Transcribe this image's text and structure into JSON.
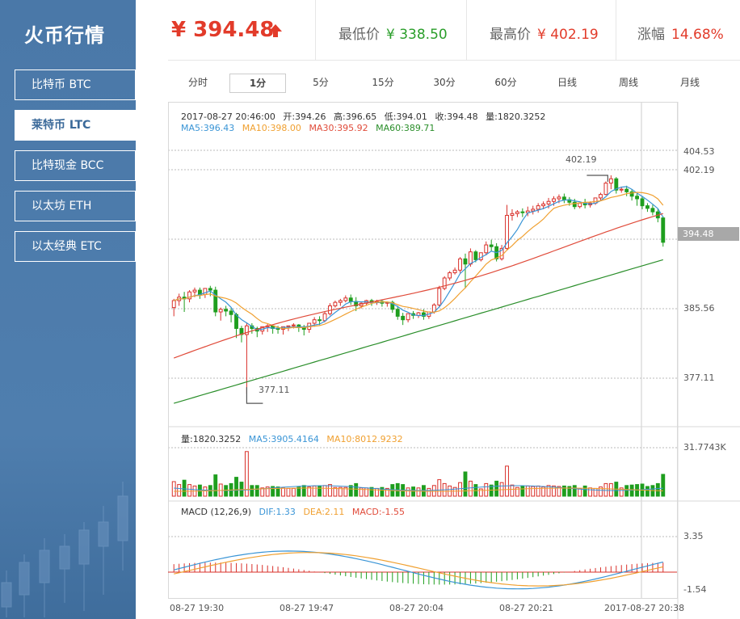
{
  "brand": "火币行情",
  "coins": [
    {
      "label": "比特币 BTC",
      "active": false
    },
    {
      "label": "莱特币 LTC",
      "active": true
    },
    {
      "label": "比特现金 BCC",
      "active": false
    },
    {
      "label": "以太坊 ETH",
      "active": false
    },
    {
      "label": "以太经典 ETC",
      "active": false
    }
  ],
  "header": {
    "price": "¥ 394.48",
    "trend_icon": "up-arrow-icon",
    "low_label": "最低价",
    "low_value": "¥ 338.50",
    "high_label": "最高价",
    "high_value": "¥ 402.19",
    "change_label": "涨幅",
    "change_value": "14.68%"
  },
  "tabs": [
    "分时",
    "1分",
    "5分",
    "15分",
    "30分",
    "60分",
    "日线",
    "周线",
    "月线"
  ],
  "active_tab": "1分",
  "candle_info": {
    "datetime": "2017-08-27 20:46:00",
    "open": "开:394.26",
    "high": "高:396.65",
    "low": "低:394.01",
    "close": "收:394.48",
    "volume": "量:1820.3252",
    "ma5": "MA5:396.43",
    "ma10": "MA10:398.00",
    "ma30": "MA30:395.92",
    "ma60": "MA60:389.71"
  },
  "volume_info": {
    "volume": "量:1820.3252",
    "ma5": "MA5:3905.4164",
    "ma10": "MA10:8012.9232"
  },
  "macd_info": {
    "title": "MACD (12,26,9)",
    "dif": "DIF:1.33",
    "dea": "DEA:2.11",
    "macd": "MACD:-1.55"
  },
  "y_axis": {
    "p1": "404.53",
    "p2": "402.19",
    "p3": "385.56",
    "p4": "377.11",
    "current": "394.48",
    "vol_max": "31.7743K",
    "macd_hi": "3.35",
    "macd_lo": "-1.54"
  },
  "annotations": {
    "high_mark": "402.19",
    "low_mark": "377.11"
  },
  "x_axis": [
    "08-27 19:30",
    "08-27 19:47",
    "08-27 20:04",
    "08-27 20:21",
    "2017-08-27 20:38"
  ],
  "colors": {
    "up": "#d9302a",
    "down": "#1e9e1e",
    "ma5": "#3a95d6",
    "ma10": "#f0a030",
    "ma30": "#e04b3a",
    "ma60": "#2a8e2a",
    "sidebar": "#4a78a8"
  },
  "chart_data": {
    "type": "candlestick",
    "price_range": [
      373.5,
      406
    ],
    "interval": "1分",
    "candles": [
      [
        387.0,
        388.0,
        387.8,
        386.0
      ],
      [
        387.8,
        388.6,
        388.2,
        387.2
      ],
      [
        388.2,
        388.8,
        388.0,
        386.5
      ],
      [
        388.0,
        389.0,
        388.8,
        387.6
      ],
      [
        388.8,
        389.3,
        389.0,
        388.2
      ],
      [
        389.0,
        389.3,
        388.5,
        388.0
      ],
      [
        388.5,
        389.0,
        389.2,
        388.1
      ],
      [
        389.2,
        389.5,
        389.0,
        388.3
      ],
      [
        389.0,
        389.4,
        386.5,
        386.0
      ],
      [
        386.5,
        387.0,
        386.8,
        385.5
      ],
      [
        386.8,
        387.2,
        386.6,
        386.0
      ],
      [
        386.6,
        386.9,
        386.2,
        385.3
      ],
      [
        386.2,
        386.4,
        384.6,
        383.5
      ],
      [
        384.6,
        384.9,
        383.9,
        383.0
      ],
      [
        383.9,
        385.3,
        384.9,
        377.1
      ],
      [
        384.9,
        385.2,
        384.6,
        384.0
      ],
      [
        384.6,
        384.8,
        384.3,
        383.6
      ],
      [
        384.3,
        384.6,
        384.8,
        383.9
      ],
      [
        384.8,
        385.1,
        384.9,
        384.2
      ],
      [
        384.9,
        385.0,
        384.6,
        384.0
      ],
      [
        384.6,
        384.9,
        384.5,
        384.0
      ],
      [
        384.5,
        384.6,
        384.8,
        383.9
      ],
      [
        384.8,
        384.9,
        384.9,
        384.3
      ],
      [
        384.9,
        385.2,
        385.0,
        384.6
      ],
      [
        385.0,
        385.1,
        384.7,
        384.2
      ],
      [
        384.7,
        385.0,
        384.5,
        383.8
      ],
      [
        384.5,
        385.0,
        385.2,
        384.1
      ],
      [
        385.2,
        385.9,
        385.6,
        384.8
      ],
      [
        385.6,
        386.0,
        385.5,
        385.0
      ],
      [
        385.5,
        386.5,
        386.3,
        385.3
      ],
      [
        386.3,
        387.5,
        387.2,
        386.1
      ],
      [
        387.2,
        387.8,
        387.6,
        387.0
      ],
      [
        387.6,
        388.0,
        387.8,
        387.2
      ],
      [
        387.8,
        388.4,
        388.1,
        387.6
      ],
      [
        388.1,
        388.5,
        387.7,
        387.3
      ],
      [
        387.7,
        388.2,
        387.2,
        386.6
      ],
      [
        387.2,
        387.6,
        387.5,
        386.9
      ],
      [
        387.5,
        387.9,
        387.8,
        387.2
      ],
      [
        387.8,
        388.0,
        387.6,
        387.2
      ],
      [
        387.6,
        387.9,
        387.7,
        387.3
      ],
      [
        387.7,
        387.9,
        387.5,
        387.1
      ],
      [
        387.5,
        387.7,
        387.6,
        387.1
      ],
      [
        387.6,
        387.8,
        386.8,
        386.4
      ],
      [
        386.8,
        387.2,
        386.0,
        385.6
      ],
      [
        386.0,
        386.4,
        385.6,
        385.0
      ],
      [
        385.6,
        386.0,
        386.3,
        385.3
      ],
      [
        386.3,
        386.6,
        386.1,
        385.7
      ],
      [
        386.1,
        386.5,
        386.4,
        385.8
      ],
      [
        386.4,
        386.8,
        386.0,
        385.6
      ],
      [
        386.0,
        386.3,
        386.5,
        385.7
      ],
      [
        386.5,
        387.5,
        387.3,
        386.3
      ],
      [
        387.3,
        389.5,
        389.2,
        387.1
      ],
      [
        389.2,
        390.6,
        390.4,
        389.0
      ],
      [
        390.4,
        391.2,
        391.0,
        390.1
      ],
      [
        391.0,
        391.6,
        391.3,
        390.8
      ],
      [
        391.3,
        392.8,
        392.6,
        391.0
      ],
      [
        392.6,
        393.2,
        392.0,
        389.2
      ],
      [
        392.0,
        393.8,
        393.4,
        391.7
      ],
      [
        393.4,
        393.6,
        392.5,
        392.2
      ],
      [
        392.5,
        392.8,
        393.3,
        392.3
      ],
      [
        393.3,
        394.6,
        394.2,
        393.0
      ],
      [
        394.2,
        394.8,
        394.0,
        393.5
      ],
      [
        394.0,
        394.4,
        392.6,
        392.3
      ],
      [
        392.6,
        394.2,
        393.8,
        392.4
      ],
      [
        393.8,
        398.8,
        397.6,
        393.6
      ],
      [
        397.6,
        398.3,
        397.8,
        397.0
      ],
      [
        397.8,
        398.2,
        398.0,
        397.4
      ],
      [
        398.0,
        398.4,
        397.9,
        397.4
      ],
      [
        397.9,
        398.6,
        398.1,
        397.5
      ],
      [
        398.1,
        398.7,
        398.3,
        397.7
      ],
      [
        398.3,
        399.0,
        398.7,
        397.9
      ],
      [
        398.7,
        399.2,
        398.9,
        398.3
      ],
      [
        398.9,
        399.6,
        399.2,
        398.4
      ],
      [
        399.2,
        399.8,
        399.5,
        398.7
      ],
      [
        399.5,
        400.0,
        399.7,
        399.0
      ],
      [
        399.7,
        400.1,
        399.4,
        399.0
      ],
      [
        399.4,
        399.7,
        399.1,
        398.7
      ],
      [
        399.1,
        399.5,
        398.6,
        398.3
      ],
      [
        398.6,
        399.0,
        399.0,
        398.4
      ],
      [
        399.0,
        399.5,
        398.8,
        398.4
      ],
      [
        398.8,
        399.2,
        399.0,
        398.5
      ],
      [
        399.0,
        399.4,
        399.6,
        398.8
      ],
      [
        399.6,
        400.2,
        400.0,
        399.3
      ],
      [
        400.0,
        401.5,
        401.3,
        399.9
      ],
      [
        401.3,
        402.2,
        401.8,
        400.6
      ],
      [
        401.8,
        402.0,
        400.5,
        400.1
      ],
      [
        400.5,
        400.9,
        400.6,
        400.2
      ],
      [
        400.6,
        401.0,
        400.3,
        399.8
      ],
      [
        400.3,
        400.6,
        399.8,
        399.3
      ],
      [
        399.8,
        400.1,
        399.5,
        398.7
      ],
      [
        399.5,
        399.8,
        398.7,
        398.3
      ],
      [
        398.7,
        399.0,
        398.4,
        398.0
      ],
      [
        398.4,
        398.8,
        398.0,
        397.6
      ],
      [
        398.0,
        398.4,
        397.3,
        396.8
      ],
      [
        397.3,
        397.5,
        394.5,
        394.0
      ]
    ],
    "ma5_overlay": true,
    "ma10_overlay": true,
    "ma30_overlay": true,
    "ma60_overlay": true
  }
}
